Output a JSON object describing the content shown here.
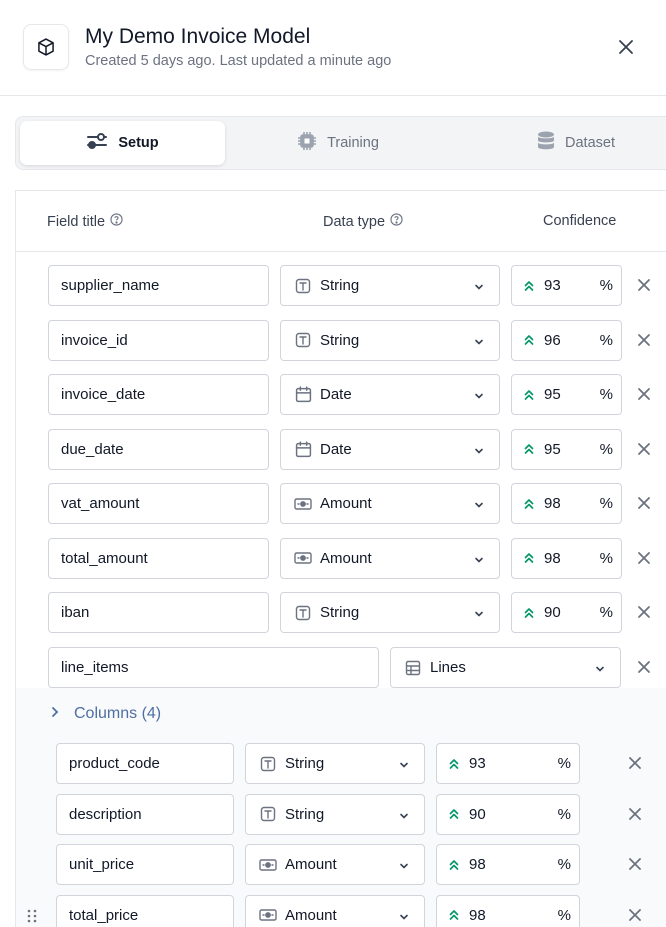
{
  "header": {
    "title": "My Demo Invoice Model",
    "subtitle": "Created 5 days ago. Last updated a minute ago",
    "icon": "cube-icon",
    "close_icon": "close-icon"
  },
  "tabs": [
    {
      "label": "Setup",
      "icon": "sliders-icon",
      "active": true
    },
    {
      "label": "Training",
      "icon": "chip-icon",
      "active": false
    },
    {
      "label": "Dataset",
      "icon": "database-icon",
      "active": false
    }
  ],
  "table": {
    "headers": {
      "field_title": "Field title",
      "data_type": "Data type",
      "confidence": "Confidence"
    },
    "fields": [
      {
        "name": "supplier_name",
        "type": "String",
        "confidence": "93"
      },
      {
        "name": "invoice_id",
        "type": "String",
        "confidence": "96"
      },
      {
        "name": "invoice_date",
        "type": "Date",
        "confidence": "95"
      },
      {
        "name": "due_date",
        "type": "Date",
        "confidence": "95"
      },
      {
        "name": "vat_amount",
        "type": "Amount",
        "confidence": "98"
      },
      {
        "name": "total_amount",
        "type": "Amount",
        "confidence": "98"
      },
      {
        "name": "iban",
        "type": "String",
        "confidence": "90"
      }
    ],
    "line_items": {
      "name": "line_items",
      "type": "Lines"
    },
    "columns_label": "Columns (4)",
    "columns": [
      {
        "name": "product_code",
        "type": "String",
        "confidence": "93"
      },
      {
        "name": "description",
        "type": "String",
        "confidence": "90"
      },
      {
        "name": "unit_price",
        "type": "Amount",
        "confidence": "98"
      },
      {
        "name": "total_price",
        "type": "Amount",
        "confidence": "98"
      }
    ],
    "percent_symbol": "%"
  },
  "colors": {
    "accent_green": "#059669",
    "link_blue": "#4f6ea3",
    "border": "#d1d5db"
  }
}
